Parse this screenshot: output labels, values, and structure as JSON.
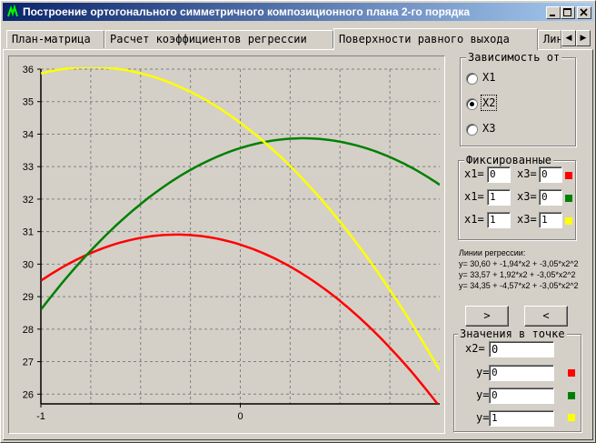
{
  "window": {
    "title": "Построение ортогонального симметричного композиционного плана 2-го порядка"
  },
  "tabs": [
    {
      "label": "План-матрица"
    },
    {
      "label": "Расчет коэффициентов регрессии"
    },
    {
      "label": "Поверхности равного выхода"
    },
    {
      "label": "Лин"
    }
  ],
  "dependence": {
    "caption": "Зависимость от",
    "options": [
      "X1",
      "X2",
      "X3"
    ],
    "selected": "X2"
  },
  "fixed": {
    "caption": "Фиксированные",
    "rows": [
      {
        "a_label": "x1=",
        "a_value": "0",
        "b_label": "x3=",
        "b_value": "0",
        "color": "#ff0000"
      },
      {
        "a_label": "x1=",
        "a_value": "1",
        "b_label": "x3=",
        "b_value": "0",
        "color": "#008000"
      },
      {
        "a_label": "x1=",
        "a_value": "1",
        "b_label": "x3=",
        "b_value": "1",
        "color": "#ffff00"
      }
    ]
  },
  "regression": {
    "title": "Линии регрессии:",
    "lines": [
      "y= 30,60 + -1,94*x2 + -3,05*x2^2",
      "y= 33,57 + 1,92*x2 + -3,05*x2^2",
      "y= 34,35 + -4,57*x2 + -3,05*x2^2"
    ]
  },
  "buttons": {
    "next": ">",
    "prev": "<"
  },
  "point_values": {
    "caption": "Значения в точке",
    "x_label": "x2=",
    "x_value": "0",
    "rows": [
      {
        "label": "y=",
        "value": "0",
        "color": "#ff0000"
      },
      {
        "label": "y=",
        "value": "0",
        "color": "#008000"
      },
      {
        "label": "y=",
        "value": "1",
        "color": "#ffff00"
      }
    ]
  },
  "chart_data": {
    "type": "line",
    "xlim": [
      -1,
      1
    ],
    "ylim": [
      25.7,
      36
    ],
    "x_ticks": [
      -1,
      0
    ],
    "y_ticks": [
      26,
      27,
      28,
      29,
      30,
      31,
      32,
      33,
      34,
      35,
      36
    ],
    "grid": true,
    "series": [
      {
        "color": "#ff0000",
        "coeffs": [
          30.6,
          -1.94,
          -3.05
        ]
      },
      {
        "color": "#008000",
        "coeffs": [
          33.57,
          1.92,
          -3.05
        ]
      },
      {
        "color": "#ffff00",
        "coeffs": [
          34.35,
          -4.57,
          -3.05
        ]
      }
    ]
  }
}
